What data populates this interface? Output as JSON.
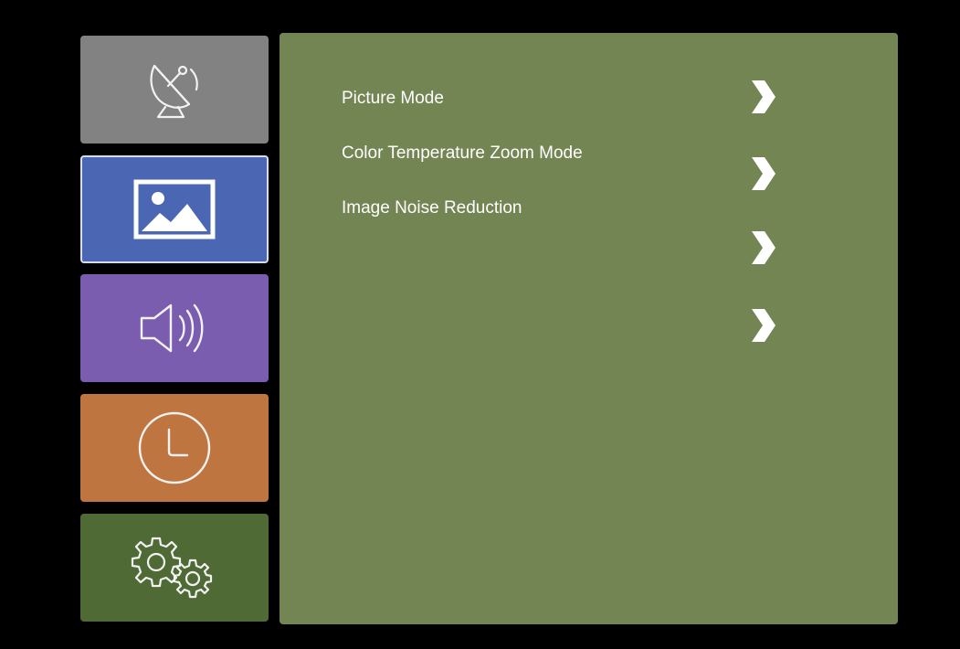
{
  "colors": {
    "background": "#000000",
    "panel": "#748554",
    "tile_channel": "#828282",
    "tile_picture": "#4b67b3",
    "tile_sound": "#7b5db0",
    "tile_time": "#bf7540",
    "tile_setup": "#4f6a35",
    "text": "#ffffff"
  },
  "sidebar": {
    "items": [
      {
        "id": "channel",
        "icon": "satellite-dish-icon",
        "selected": false
      },
      {
        "id": "picture",
        "icon": "image-icon",
        "selected": true
      },
      {
        "id": "sound",
        "icon": "speaker-icon",
        "selected": false
      },
      {
        "id": "time",
        "icon": "clock-icon",
        "selected": false
      },
      {
        "id": "setup",
        "icon": "gears-icon",
        "selected": false
      }
    ]
  },
  "menu": {
    "items": [
      {
        "label": "Picture Mode"
      },
      {
        "label": "Color Temperature Zoom Mode"
      },
      {
        "label": "Image Noise Reduction"
      }
    ],
    "arrow_count": 4,
    "arrow_icon": "chevron-right-icon"
  }
}
